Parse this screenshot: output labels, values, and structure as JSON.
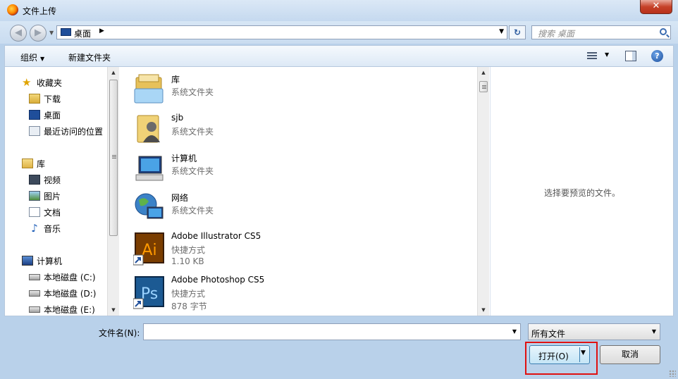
{
  "window": {
    "title": "文件上传",
    "close_label": "✕"
  },
  "address": {
    "location": "桌面",
    "search_placeholder": "搜索 桌面"
  },
  "toolbar": {
    "organize": "组织",
    "new_folder": "新建文件夹"
  },
  "nav": {
    "favorites": {
      "label": "收藏夹",
      "items": [
        "下载",
        "桌面",
        "最近访问的位置"
      ]
    },
    "libraries": {
      "label": "库",
      "items": [
        "视频",
        "图片",
        "文档",
        "音乐"
      ]
    },
    "computer": {
      "label": "计算机",
      "items": [
        "本地磁盘 (C:)",
        "本地磁盘 (D:)",
        "本地磁盘 (E:)"
      ]
    }
  },
  "files": [
    {
      "name": "库",
      "type": "系统文件夹",
      "icon": "library-icon"
    },
    {
      "name": "sjb",
      "type": "系统文件夹",
      "icon": "user-folder-icon"
    },
    {
      "name": "计算机",
      "type": "系统文件夹",
      "icon": "computer-icon"
    },
    {
      "name": "网络",
      "type": "系统文件夹",
      "icon": "network-icon"
    },
    {
      "name": "Adobe Illustrator CS5",
      "type": "快捷方式",
      "size": "1.10 KB",
      "icon": "illustrator-icon",
      "icon_text": "Ai"
    },
    {
      "name": "Adobe Photoshop CS5",
      "type": "快捷方式",
      "size": "878 字节",
      "icon": "photoshop-icon",
      "icon_text": "Ps"
    }
  ],
  "preview": {
    "text": "选择要预览的文件。"
  },
  "bottom": {
    "filename_label": "文件名(N):",
    "filename_value": "",
    "filter_selected": "所有文件",
    "open_label": "打开(O)",
    "cancel_label": "取消"
  },
  "colors": {
    "highlight": "#e01010",
    "window_frame": "#b9d1ea",
    "selected_button": "#c4e5f6"
  }
}
